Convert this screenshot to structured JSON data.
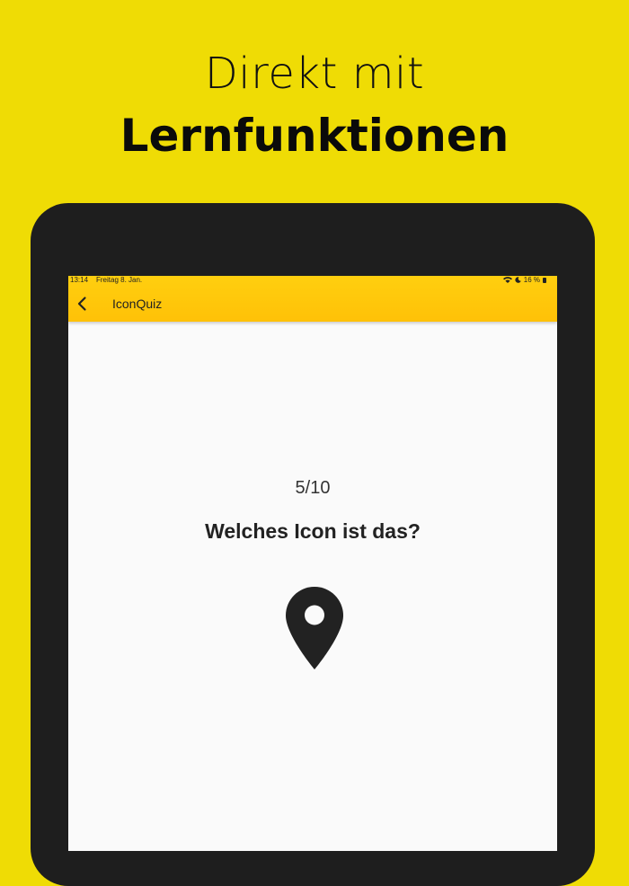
{
  "headline": {
    "line1": "Direkt mit",
    "line2": "Lernfunktionen"
  },
  "status_bar": {
    "time": "13:14",
    "date": "Freitag 8. Jan.",
    "battery": "16 %"
  },
  "appbar": {
    "title": "IconQuiz",
    "back_icon": "chevron-left-icon"
  },
  "quiz": {
    "progress": "5/10",
    "question": "Welches Icon ist das?",
    "icon": "location-pin-icon"
  },
  "colors": {
    "background": "#efdc05",
    "device": "#1e1e1e",
    "appbar": "#ffc107",
    "screen": "#fafafa"
  }
}
